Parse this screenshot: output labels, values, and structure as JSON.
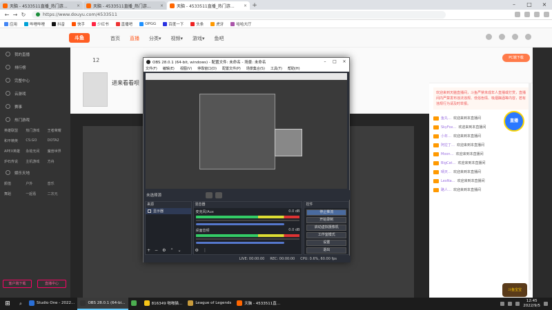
{
  "browser": {
    "tabs": [
      {
        "label": "天脑 - 4533511直播_热门游…"
      },
      {
        "label": "天脑 - 4533511直播_热门游…"
      },
      {
        "label": "天脑 - 4533511直播_热门游…"
      }
    ],
    "new_tab": "+",
    "url": "https://www.douyu.com/4533511",
    "bookmarks": [
      "应用",
      "哔哩哔哩",
      "抖音",
      "快手",
      "少红书",
      "直播吧",
      "OPGG",
      "百度一下",
      "头条",
      "虎牙",
      "哈哈大厅"
    ],
    "bookmark_colors": [
      "#4285f4",
      "#00a1d6",
      "#111111",
      "#ff5000",
      "#ff2442",
      "#e33",
      "#1e90ff",
      "#2932e1",
      "#e22",
      "#f90",
      "#a5a"
    ]
  },
  "site": {
    "logo": "斗鱼",
    "nav": [
      "首页",
      "直播",
      "分类▾",
      "视频▾",
      "游戏▾",
      "鱼吧"
    ],
    "active_nav": "直播",
    "sidebar_items": [
      "我的直播",
      "排行榜",
      "完整中心",
      "云游戏",
      "赛事"
    ],
    "sidebar_sections": {
      "games_title": "热门游戏",
      "games": [
        "英雄联盟",
        "热门游戏",
        "王者荣耀",
        "和平精英",
        "CS:GO",
        "DOTA2",
        "APEX英雄",
        "永劫无间",
        "魔兽世界",
        "炉石传说",
        "主机游戏",
        "方舟"
      ],
      "yule_title": "娱乐天地",
      "yule": [
        "颜值",
        "户外",
        "音乐",
        "舞蹈",
        "一起看",
        "二次元"
      ]
    },
    "sidebar_buttons": [
      "客户端下载",
      "直播中心"
    ],
    "stream_count": "12",
    "stream_title": "进来看看呗",
    "pc_login": "PC端下载",
    "float_btn": "直播",
    "mascot": "斗鱼宝宝",
    "chat_notice": "欢迎来到天脑直播间，斗鱼严禁未成年人直播或打赏，直播间内严禁发布违法违规、低俗色情、吸烟酗酒等内容，若有违规行为请及时举报。",
    "chat": [
      {
        "user": "鱼丸…",
        "msg": "欢迎来到本直播间"
      },
      {
        "user": "SkyFox…",
        "msg": "欢迎来到本直播间"
      },
      {
        "user": "小年…",
        "msg": "欢迎来到本直播间"
      },
      {
        "user": "阿拉丁…",
        "msg": "欢迎来到本直播间"
      },
      {
        "user": "Moon…",
        "msg": "欢迎来到本直播间"
      },
      {
        "user": "BigCat…",
        "msg": "欢迎来到本直播间"
      },
      {
        "user": "晴天…",
        "msg": "欢迎来到本直播间"
      },
      {
        "user": "LeoNa…",
        "msg": "欢迎来到本直播间"
      },
      {
        "user": "路人…",
        "msg": "欢迎来到本直播间"
      }
    ]
  },
  "obs": {
    "title": "OBS 28.0.1 (64-bit, windows) - 配置文件: 未命名 - 场景: 未命名",
    "menu": [
      "文件(F)",
      "编辑(E)",
      "视图(V)",
      "停靠窗口(D)",
      "配置文件(P)",
      "场景集合(S)",
      "工具(T)",
      "帮助(H)"
    ],
    "source_label": "未选择源",
    "panes": {
      "scenes": "来源",
      "mixer": "混音器",
      "controls": "控件"
    },
    "scene_item": "显示器",
    "mixer": [
      {
        "name": "麦克风/Aux",
        "db": "0.0 dB"
      },
      {
        "name": "桌面音频",
        "db": "0.0 dB"
      }
    ],
    "controls": [
      "停止推流",
      "开始录制",
      "启动虚拟摄像机",
      "工作室模式",
      "设置",
      "退出"
    ],
    "status": {
      "live": "LIVE: 00:00:00",
      "rec": "REC: 00:00:00",
      "cpu": "CPU: 0.6%, 60.00 fps"
    }
  },
  "taskbar": {
    "items": [
      {
        "label": "Studio One - 2022…",
        "color": "#2a6fd6"
      },
      {
        "label": "OBS 28.0.1 (64-bi…",
        "color": "#333333"
      },
      {
        "label": "",
        "color": "#4caf50"
      },
      {
        "label": "816349 啪啪猫…",
        "color": "#f5c518"
      },
      {
        "label": "League of Legends",
        "color": "#c89b3c"
      },
      {
        "label": "天脑 - 4533511直…",
        "color": "#ff6600"
      }
    ],
    "active_index": 1,
    "time": "12:45",
    "date": "2022/9/5"
  }
}
